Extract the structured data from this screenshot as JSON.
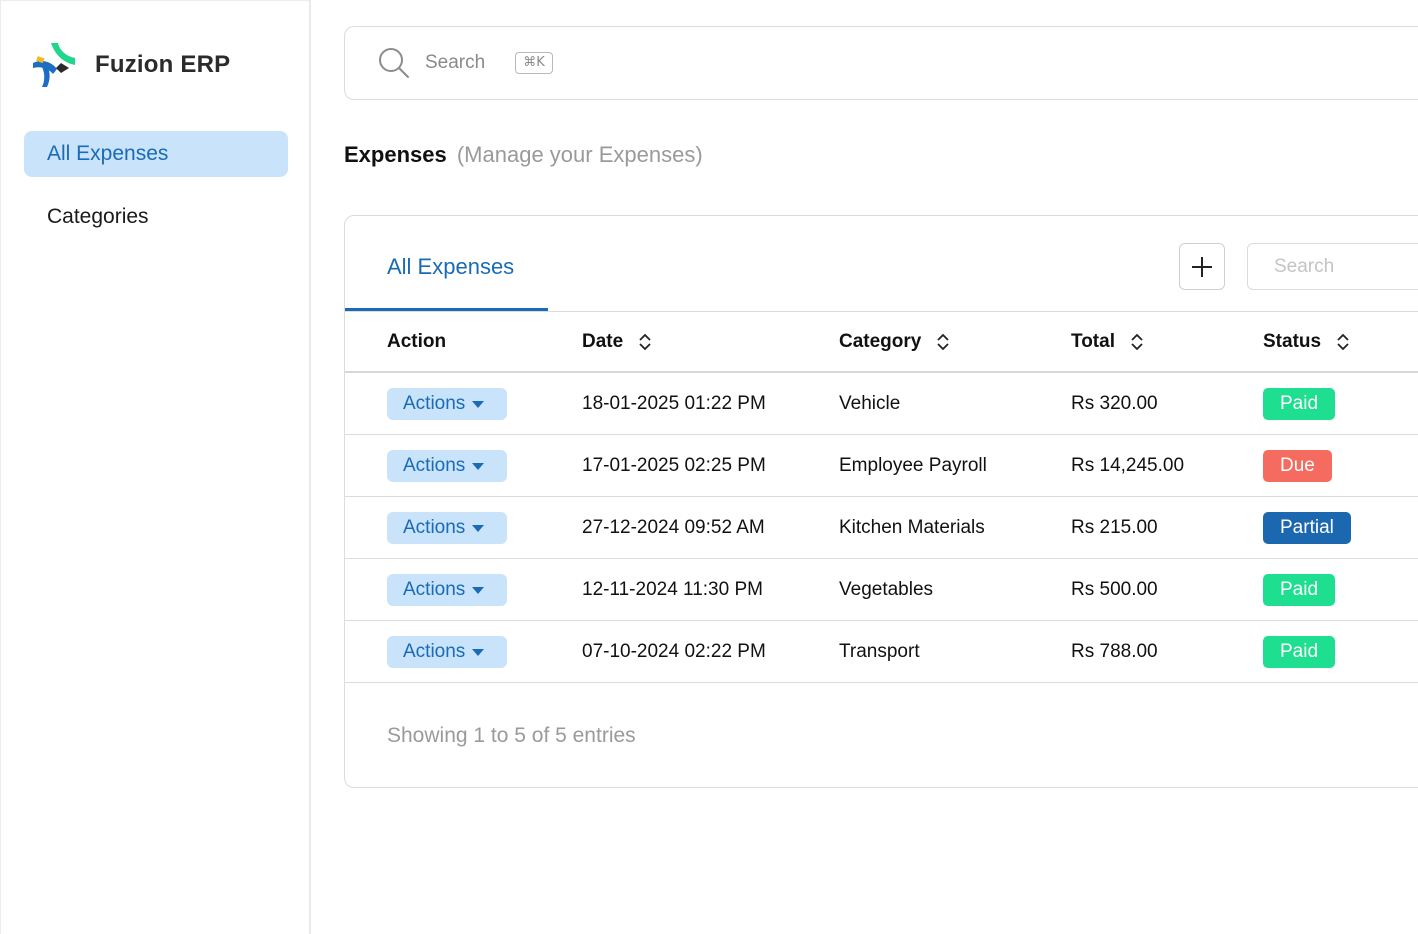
{
  "app": {
    "name": "Fuzion ERP"
  },
  "sidebar": {
    "items": [
      {
        "label": "All Expenses",
        "active": true
      },
      {
        "label": "Categories",
        "active": false
      }
    ]
  },
  "topbar": {
    "search_label": "Search",
    "shortcut": "⌘K"
  },
  "page": {
    "title": "Expenses",
    "subtitle": "(Manage your Expenses)"
  },
  "card": {
    "tab_label": "All Expenses",
    "search_placeholder": "Search",
    "add_icon": "plus-icon"
  },
  "table": {
    "columns": [
      "Action",
      "Date",
      "Category",
      "Total",
      "Status"
    ],
    "action_label": "Actions",
    "rows": [
      {
        "date": "18-01-2025 01:22 PM",
        "category": "Vehicle",
        "total": "Rs 320.00",
        "status": "Paid"
      },
      {
        "date": "17-01-2025 02:25 PM",
        "category": "Employee Payroll",
        "total": "Rs 14,245.00",
        "status": "Due"
      },
      {
        "date": "27-12-2024 09:52 AM",
        "category": "Kitchen Materials",
        "total": "Rs 215.00",
        "status": "Partial"
      },
      {
        "date": "12-11-2024 11:30 PM",
        "category": "Vegetables",
        "total": "Rs 500.00",
        "status": "Paid"
      },
      {
        "date": "07-10-2024 02:22 PM",
        "category": "Transport",
        "total": "Rs 788.00",
        "status": "Paid"
      }
    ]
  },
  "status_colors": {
    "Paid": "#1ede8f",
    "Due": "#f66b5f",
    "Partial": "#1c68b0"
  },
  "footer": {
    "info": "Showing 1 to 5  of 5 entries"
  },
  "colors": {
    "accent": "#1a6bb5",
    "accent_bg": "#c9e3fb"
  }
}
